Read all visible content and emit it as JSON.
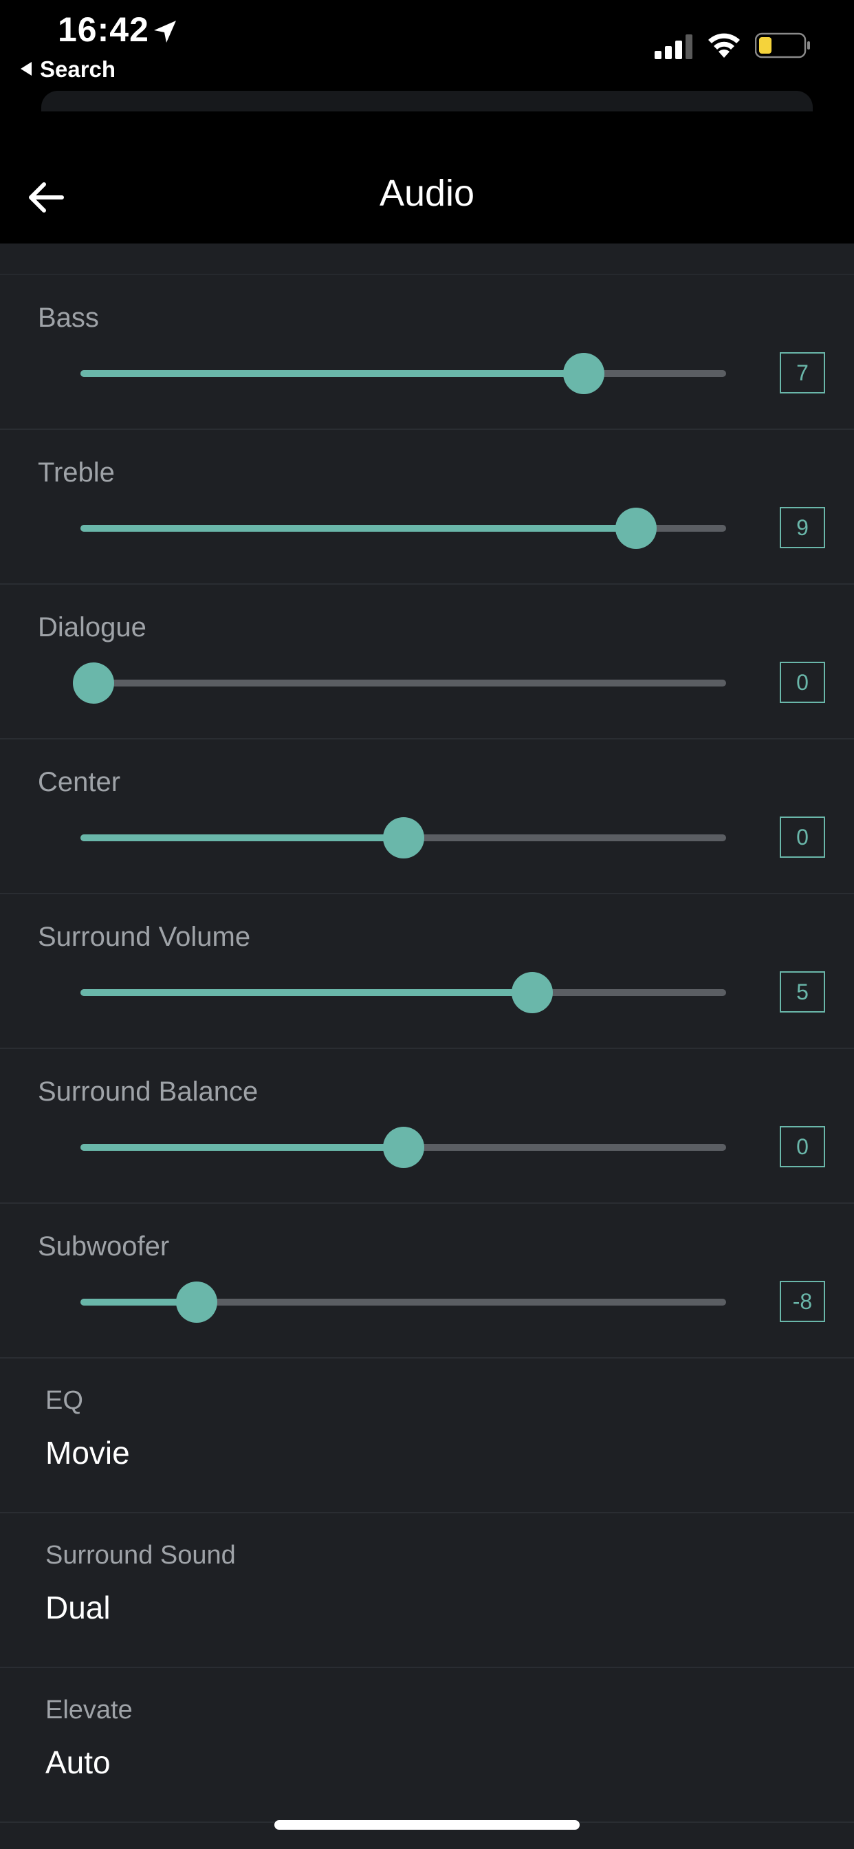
{
  "status_bar": {
    "time": "16:42",
    "back_app": "Search",
    "battery_color": "#f5d33b"
  },
  "nav": {
    "title": "Audio"
  },
  "sliders": [
    {
      "label": "Bass",
      "value": "7",
      "level": 0.78
    },
    {
      "label": "Treble",
      "value": "9",
      "level": 0.86
    },
    {
      "label": "Dialogue",
      "value": "0",
      "level": 0.02
    },
    {
      "label": "Center",
      "value": "0",
      "level": 0.5
    },
    {
      "label": "Surround Volume",
      "value": "5",
      "level": 0.7
    },
    {
      "label": "Surround Balance",
      "value": "0",
      "level": 0.5
    },
    {
      "label": "Subwoofer",
      "value": "-8",
      "level": 0.18
    }
  ],
  "options": [
    {
      "label": "EQ",
      "value": "Movie"
    },
    {
      "label": "Surround Sound",
      "value": "Dual"
    },
    {
      "label": "Elevate",
      "value": "Auto"
    }
  ],
  "colors": {
    "accent": "#6ab7aa",
    "background": "#1e2024",
    "track": "#5b5e63"
  }
}
